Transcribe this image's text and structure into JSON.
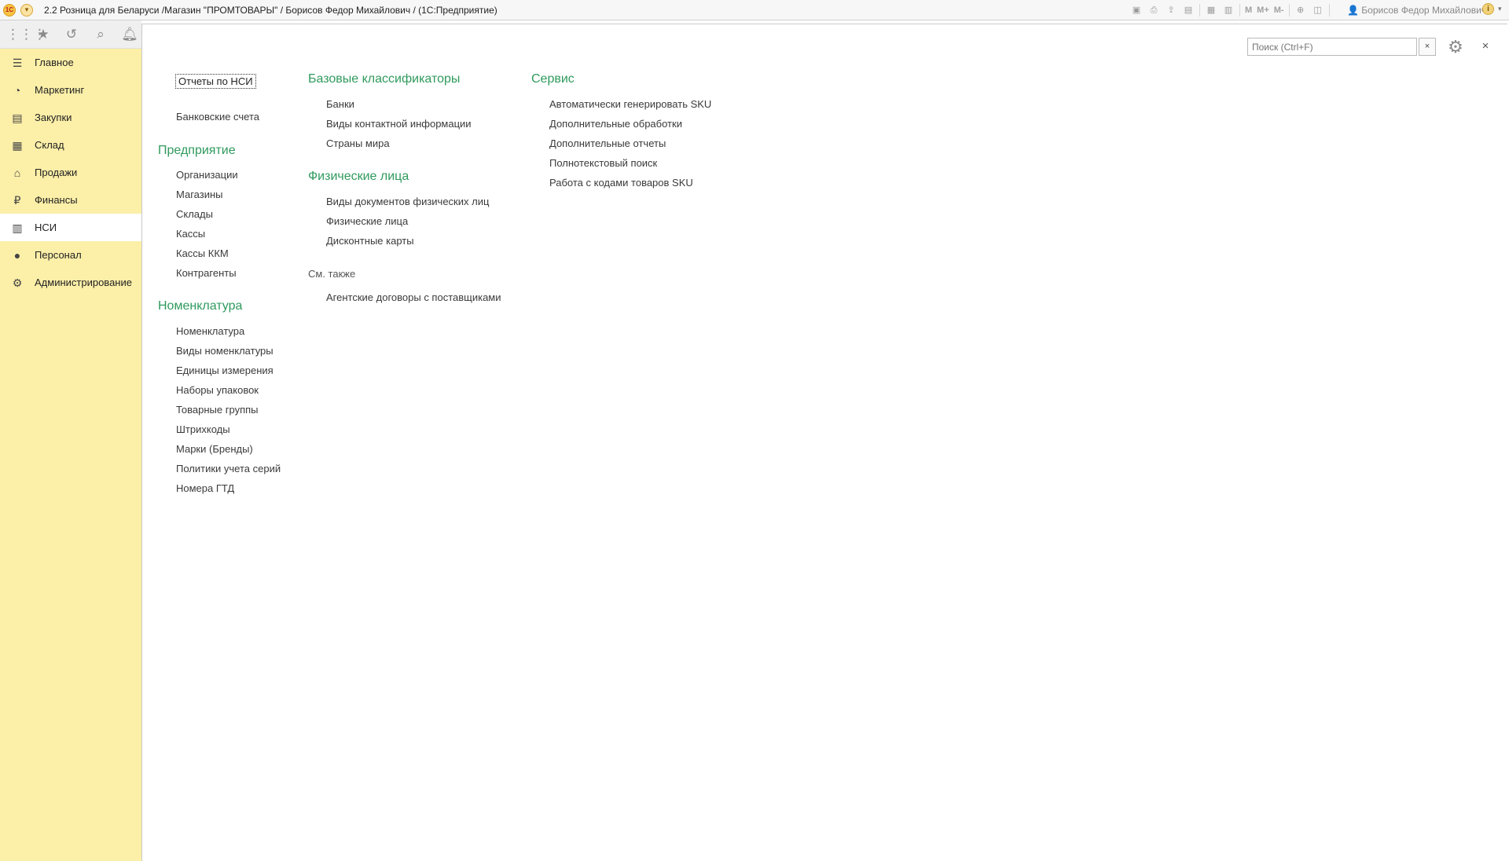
{
  "window": {
    "title": "2.2 Розница для Беларуси /Магазин \"ПРОМТОВАРЫ\" / Борисов Федор Михайлович /  (1С:Предприятие)",
    "logo_text": "1С",
    "user": "Борисов Федор Михайлович",
    "toolbar_text": {
      "m": "M",
      "m_plus": "M+",
      "m_minus": "M-"
    }
  },
  "toolrow": {
    "icons": [
      "apps-grid-icon",
      "favorites-star-icon",
      "history-icon",
      "search-icon",
      "notifications-bell-icon"
    ]
  },
  "sidebar": {
    "items": [
      {
        "label": "Главное",
        "icon": "menu-lines-icon"
      },
      {
        "label": "Маркетинг",
        "icon": "pie-chart-icon"
      },
      {
        "label": "Закупки",
        "icon": "cart-icon"
      },
      {
        "label": "Склад",
        "icon": "warehouse-icon"
      },
      {
        "label": "Продажи",
        "icon": "basket-icon"
      },
      {
        "label": "Финансы",
        "icon": "ruble-icon"
      },
      {
        "label": "НСИ",
        "icon": "books-icon"
      },
      {
        "label": "Персонал",
        "icon": "person-icon"
      },
      {
        "label": "Администрирование",
        "icon": "gear-icon"
      }
    ],
    "active": "НСИ"
  },
  "search": {
    "placeholder": "Поиск (Ctrl+F)",
    "clear": "×"
  },
  "close_label": "×",
  "content": {
    "reports_link": "Отчеты по НСИ",
    "bank_accounts": "Банковские счета",
    "enterprise": {
      "title": "Предприятие",
      "items": [
        "Организации",
        "Магазины",
        "Склады",
        "Кассы",
        "Кассы ККМ",
        "Контрагенты"
      ]
    },
    "nomenclature": {
      "title": "Номенклатура",
      "items": [
        "Номенклатура",
        "Виды номенклатуры",
        "Единицы измерения",
        "Наборы упаковок",
        "Товарные группы",
        "Штрихкоды",
        "Марки (Бренды)",
        "Политики учета серий",
        "Номера ГТД"
      ]
    },
    "base_classifiers": {
      "title": "Базовые классификаторы",
      "items": [
        "Банки",
        "Виды контактной информации",
        "Страны мира"
      ]
    },
    "individuals": {
      "title": "Физические лица",
      "items": [
        "Виды документов физических лиц",
        "Физические лица",
        "Дисконтные карты"
      ]
    },
    "see_also": {
      "title": "См. также",
      "items": [
        "Агентские договоры с поставщиками"
      ]
    },
    "service": {
      "title": "Сервис",
      "items": [
        "Автоматически генерировать SKU",
        "Дополнительные обработки",
        "Дополнительные отчеты",
        "Полнотекстовый поиск",
        "Работа с кодами товаров SKU"
      ]
    }
  },
  "colors": {
    "sidebar_bg": "#fcefa8",
    "section_title": "#2f9a5d",
    "active_item_bg": "#ffffff"
  }
}
